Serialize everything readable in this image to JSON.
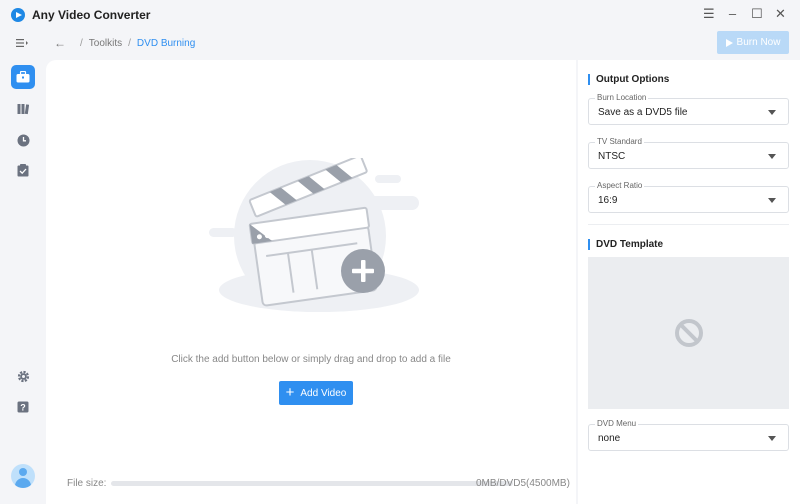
{
  "app": {
    "title": "Any Video Converter"
  },
  "breadcrumb": {
    "parent": "Toolkits",
    "current": "DVD Burning"
  },
  "toolbar": {
    "burn_label": "Burn Now"
  },
  "main": {
    "hint": "Click the add button below or simply drag and drop to add a file",
    "add_label": "Add Video",
    "filesize_label": "File size:",
    "filesize_value": "0MB/DVD5(4500MB)",
    "filesize_fraction": 0
  },
  "output_options": {
    "title": "Output Options",
    "burn_location": {
      "label": "Burn Location",
      "value": "Save as a DVD5 file"
    },
    "tv_standard": {
      "label": "TV Standard",
      "value": "NTSC"
    },
    "aspect_ratio": {
      "label": "Aspect Ratio",
      "value": "16:9"
    }
  },
  "dvd_template": {
    "title": "DVD Template",
    "menu": {
      "label": "DVD Menu",
      "value": "none"
    }
  },
  "colors": {
    "accent": "#2f8ff0",
    "disabled_accent": "#b9d9f7"
  },
  "icons": [
    "menu-collapse-icon",
    "toolbox-icon",
    "library-icon",
    "history-icon",
    "tasks-icon",
    "settings-icon",
    "help-icon",
    "avatar",
    "back-arrow-icon",
    "play-icon",
    "clapperboard-icon",
    "plus-icon",
    "prohibited-icon",
    "chevron-down-icon"
  ]
}
